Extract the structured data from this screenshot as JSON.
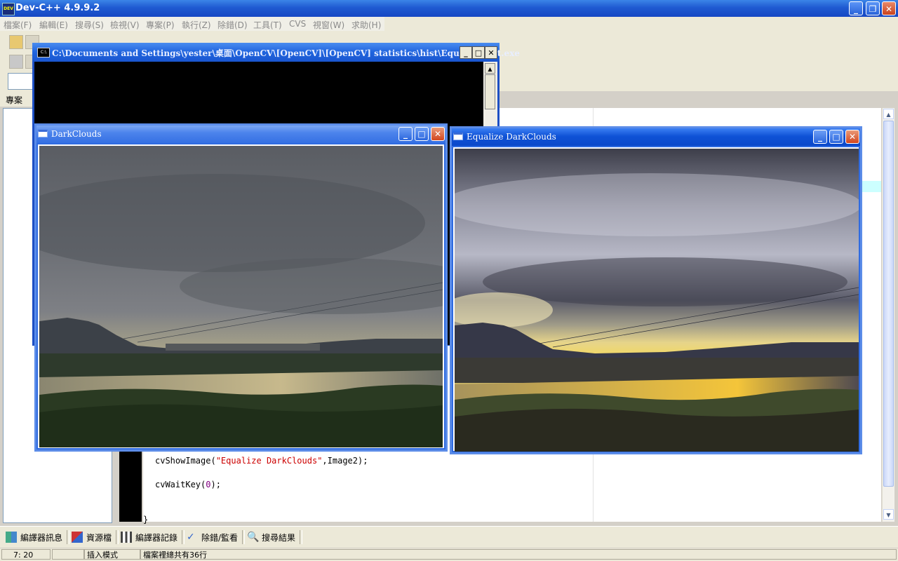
{
  "ide": {
    "title": "Dev-C++ 4.9.9.2",
    "app_icon_text": "DEV",
    "menu": [
      "檔案(F)",
      "編輯(E)",
      "搜尋(S)",
      "檢視(V)",
      "專案(P)",
      "執行(Z)",
      "除錯(D)",
      "工具(T)",
      "CVS",
      "視窗(W)",
      "求助(H)"
    ],
    "project_tab": "專案"
  },
  "console": {
    "icon_text": "C:\\",
    "title": "C:\\Documents and Settings\\yester\\桌面\\OpenCV\\[OpenCV]\\[OpenCV] statistics\\hist\\EqualizeHist.exe"
  },
  "windows": {
    "original": {
      "title": "DarkClouds"
    },
    "equalized": {
      "title": "Equalize DarkClouds"
    }
  },
  "code": {
    "line1_fn": "cvShowImage(",
    "line1_str": "\"Equalize DarkClouds\"",
    "line1_rest": ",Image2);",
    "line2_fn": "cvWaitKey(",
    "line2_num": "0",
    "line2_rest": ");",
    "brace": "}"
  },
  "bottom_tabs": [
    "編譯器訊息",
    "資源檔",
    "編譯器記錄",
    "除錯/監看",
    "搜尋結果"
  ],
  "status": {
    "position": "7: 20",
    "mode": "插入模式",
    "lines": "檔案裡總共有36行"
  },
  "icons": {
    "minimize": "minimize-icon",
    "maximize": "maximize-icon",
    "restore": "restore-icon",
    "close": "close-icon"
  },
  "colors": {
    "xp_title_blue": "#0a48ca",
    "string_red": "#cc0000",
    "number_purple": "#800080"
  }
}
